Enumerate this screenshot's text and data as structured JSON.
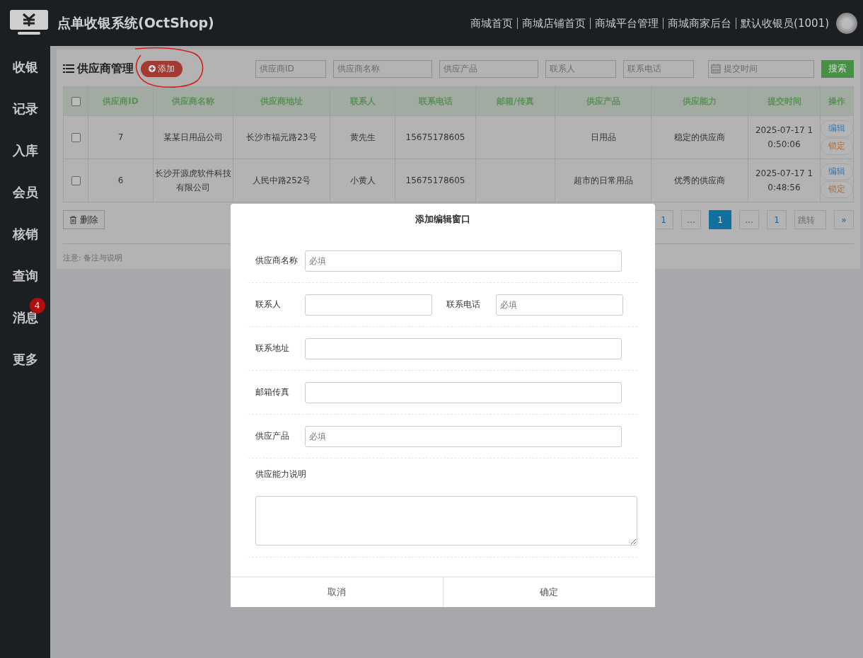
{
  "header": {
    "title": "点单收银系统(OctShop)",
    "links": [
      "商城首页",
      "商城店铺首页",
      "商城平台管理",
      "商城商家后台",
      "默认收银员(1001)"
    ]
  },
  "sidebar": {
    "items": [
      {
        "label": "收银"
      },
      {
        "label": "记录"
      },
      {
        "label": "入库"
      },
      {
        "label": "会员"
      },
      {
        "label": "核销"
      },
      {
        "label": "查询"
      },
      {
        "label": "消息",
        "badge": "4"
      },
      {
        "label": "更多"
      }
    ]
  },
  "panel": {
    "title": "供应商管理",
    "add_button": "添加",
    "filters": [
      {
        "kind": "text",
        "placeholder": "供应商ID"
      },
      {
        "kind": "text",
        "placeholder": "供应商名称"
      },
      {
        "kind": "text",
        "placeholder": "供应产品"
      },
      {
        "kind": "text",
        "placeholder": "联系人"
      },
      {
        "kind": "text",
        "placeholder": "联系电话"
      },
      {
        "kind": "date",
        "placeholder": "提交时间"
      }
    ],
    "search_button": "搜索",
    "table": {
      "select_all_checked": false,
      "columns": [
        "供应商ID",
        "供应商名称",
        "供应商地址",
        "联系人",
        "联系电话",
        "邮箱/传真",
        "供应产品",
        "供应能力",
        "提交时间",
        "操作"
      ],
      "rows": [
        {
          "checked": false,
          "cells": [
            "7",
            "某某日用品公司",
            "长沙市福元路23号",
            "黄先生",
            "15675178605",
            "",
            "日用品",
            "稳定的供应商",
            "2025-07-17 10:50:06"
          ],
          "actions": [
            "编辑",
            "锁定"
          ]
        },
        {
          "checked": false,
          "cells": [
            "6",
            "长沙开源虎软件科技有限公司",
            "人民中路252号",
            "小黄人",
            "15675178605",
            "",
            "超市的日常用品",
            "优秀的供应商",
            "2025-07-17 10:48:56"
          ],
          "actions": [
            "编辑",
            "锁定"
          ]
        }
      ]
    },
    "delete_button": "删除",
    "pagination": [
      {
        "label": "1",
        "selected": false
      },
      {
        "label": "...",
        "selected": false
      },
      {
        "label": "1",
        "selected": true
      },
      {
        "label": "...",
        "selected": false
      },
      {
        "label": "1",
        "selected": false
      }
    ],
    "jump_placeholder": "跳转",
    "next": "»",
    "note": "注意: 备注与说明"
  },
  "dialog": {
    "title": "添加编辑窗口",
    "rows": [
      {
        "fields": [
          {
            "label": "供应商名称",
            "placeholder": "必填"
          }
        ]
      },
      {
        "fields": [
          {
            "label": "联系人"
          },
          {
            "label": "联系电话",
            "placeholder": "必填"
          }
        ]
      },
      {
        "fields": [
          {
            "label": "联系地址"
          }
        ]
      },
      {
        "fields": [
          {
            "label": "邮箱传真"
          }
        ]
      },
      {
        "fields": [
          {
            "label": "供应产品",
            "placeholder": "必填"
          }
        ]
      }
    ],
    "textarea_label": "供应能力说明",
    "buttons": [
      "取消",
      "确定"
    ]
  }
}
